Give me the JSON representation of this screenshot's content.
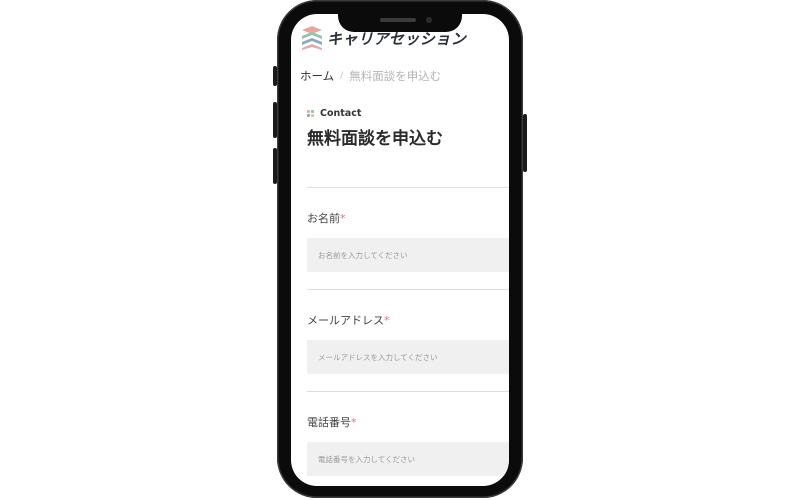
{
  "brand": {
    "name": "キャリアセッション",
    "logo_icon": "stacked-chevrons-logo",
    "colors": [
      "#e8a6a0",
      "#8fc5a8",
      "#8aa9c9"
    ]
  },
  "breadcrumb": {
    "home": "ホーム",
    "separator": "/",
    "current": "無料面談を申込む"
  },
  "section": {
    "eyebrow": "Contact",
    "eyebrow_icon": "four-dots-icon",
    "title": "無料面談を申込む"
  },
  "form": {
    "required_mark": "*",
    "fields": [
      {
        "label": "お名前",
        "placeholder": "お名前を入力してください",
        "value": ""
      },
      {
        "label": "メールアドレス",
        "placeholder": "メールアドレスを入力してください",
        "value": ""
      },
      {
        "label": "電話番号",
        "placeholder": "電話番号を入力してください",
        "value": ""
      }
    ]
  },
  "colors": {
    "required": "#e0707a",
    "input_bg": "#f0f0f0",
    "phone_frame": "#0b0b0b"
  }
}
